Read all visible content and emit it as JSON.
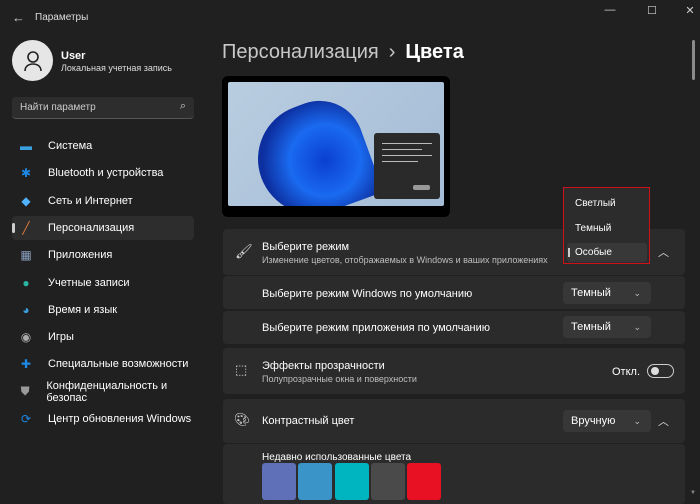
{
  "window": {
    "title": "Параметры",
    "minimize": "—",
    "maximize": "☐",
    "close": "✕"
  },
  "user": {
    "name": "User",
    "account": "Локальная учетная запись"
  },
  "search": {
    "placeholder": "Найти параметр"
  },
  "nav": [
    {
      "label": "Система",
      "icon": "monitor-icon",
      "color": "#3aa0e0"
    },
    {
      "label": "Bluetooth и устройства",
      "icon": "bluetooth-icon",
      "color": "#1e88e5"
    },
    {
      "label": "Сеть и Интернет",
      "icon": "wifi-icon",
      "color": "#4fb3ff"
    },
    {
      "label": "Персонализация",
      "icon": "brush-icon",
      "color": "#e07b39",
      "selected": true
    },
    {
      "label": "Приложения",
      "icon": "apps-icon",
      "color": "#8aa0c0"
    },
    {
      "label": "Учетные записи",
      "icon": "person-icon",
      "color": "#2ab5a0"
    },
    {
      "label": "Время и язык",
      "icon": "globe-clock-icon",
      "color": "#3aa0e0"
    },
    {
      "label": "Игры",
      "icon": "gamepad-icon",
      "color": "#aaaaaa"
    },
    {
      "label": "Специальные возможности",
      "icon": "accessibility-icon",
      "color": "#1e88e5"
    },
    {
      "label": "Конфиденциальность и безопас",
      "icon": "shield-icon",
      "color": "#999999"
    },
    {
      "label": "Центр обновления Windows",
      "icon": "update-icon",
      "color": "#1e88e5"
    }
  ],
  "breadcrumb": {
    "parent": "Персонализация",
    "separator": "›",
    "current": "Цвета"
  },
  "mode": {
    "title": "Выберите режим",
    "subtitle": "Изменение цветов, отображаемых в Windows и ваших приложениях",
    "options": [
      "Светлый",
      "Темный",
      "Особые"
    ],
    "selected": "Особые",
    "windows_label": "Выберите режим Windows по умолчанию",
    "windows_value": "Темный",
    "app_label": "Выберите режим приложения по умолчанию",
    "app_value": "Темный"
  },
  "transparency": {
    "title": "Эффекты прозрачности",
    "subtitle": "Полупрозрачные окна и поверхности",
    "state": "Откл.",
    "on": false
  },
  "accent": {
    "title": "Контрастный цвет",
    "value": "Вручную",
    "recent_label": "Недавно использованные цвета",
    "recent_colors": [
      "#6070b8",
      "#3a94c8",
      "#00b4c0",
      "#4a4a4a",
      "#e81123"
    ]
  }
}
